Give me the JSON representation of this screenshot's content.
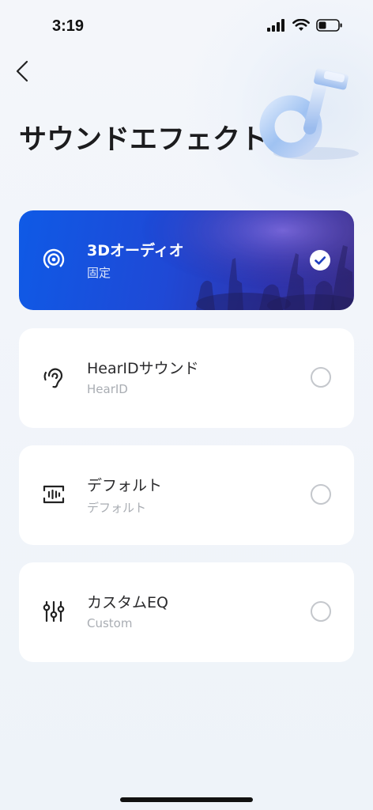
{
  "status_bar": {
    "time": "3:19"
  },
  "header": {
    "title": "サウンドエフェクト"
  },
  "options": [
    {
      "title": "3Dオーディオ",
      "subtitle": "固定",
      "icon": "3d-audio-icon",
      "selected": true
    },
    {
      "title": "HearIDサウンド",
      "subtitle": "HearID",
      "icon": "ear-icon",
      "selected": false
    },
    {
      "title": "デフォルト",
      "subtitle": "デフォルト",
      "icon": "waveform-icon",
      "selected": false
    },
    {
      "title": "カスタムEQ",
      "subtitle": "Custom",
      "icon": "equalizer-sliders-icon",
      "selected": false
    }
  ],
  "colors": {
    "accent": "#1f49d6",
    "background": "#f2f5f9",
    "card": "#ffffff",
    "title_text": "#1c1c1e",
    "sub_text": "#a9adb3"
  }
}
